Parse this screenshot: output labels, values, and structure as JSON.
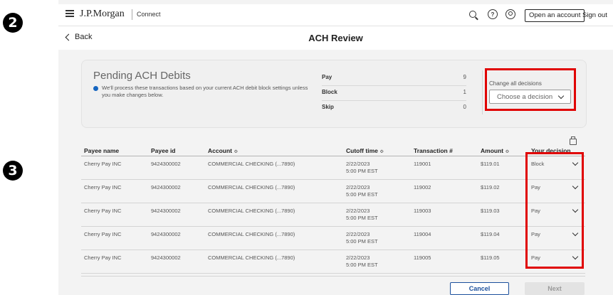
{
  "callouts": {
    "step_a": "2",
    "step_b": "3"
  },
  "header": {
    "logo": "J.P.Morgan",
    "product": "Connect",
    "open_account": "Open an account",
    "sign_out": "Sign out",
    "help_glyph": "?"
  },
  "subheader": {
    "back": "Back",
    "title": "ACH Review"
  },
  "summary_card": {
    "title": "Pending ACH Debits",
    "note": "We'll process these transactions based on your current ACH debit block settings unless you make changes below.",
    "rows": [
      {
        "label": "Pay",
        "value": "9"
      },
      {
        "label": "Block",
        "value": "1"
      },
      {
        "label": "Skip",
        "value": "0"
      }
    ],
    "change_all_label": "Change all decisions",
    "change_all_placeholder": "Choose a decision"
  },
  "table": {
    "columns": [
      "Payee name",
      "Payee id",
      "Account",
      "Cutoff time",
      "Transaction #",
      "Amount",
      "Your decision"
    ],
    "sort_glyph": "≎",
    "rows": [
      {
        "payee": "Cherry Pay INC",
        "payee_id": "9424300002",
        "account": "COMMERCIAL CHECKING (...7890)",
        "cutoff_date": "2/22/2023",
        "cutoff_time": "5:00 PM EST",
        "txn": "119001",
        "amount": "$119.01",
        "decision": "Block"
      },
      {
        "payee": "Cherry Pay INC",
        "payee_id": "9424300002",
        "account": "COMMERCIAL CHECKING (...7890)",
        "cutoff_date": "2/22/2023",
        "cutoff_time": "5:00 PM EST",
        "txn": "119002",
        "amount": "$119.02",
        "decision": "Pay"
      },
      {
        "payee": "Cherry Pay INC",
        "payee_id": "9424300002",
        "account": "COMMERCIAL CHECKING (...7890)",
        "cutoff_date": "2/22/2023",
        "cutoff_time": "5:00 PM EST",
        "txn": "119003",
        "amount": "$119.03",
        "decision": "Pay"
      },
      {
        "payee": "Cherry Pay INC",
        "payee_id": "9424300002",
        "account": "COMMERCIAL CHECKING (...7890)",
        "cutoff_date": "2/22/2023",
        "cutoff_time": "5:00 PM EST",
        "txn": "119004",
        "amount": "$119.04",
        "decision": "Pay"
      },
      {
        "payee": "Cherry Pay INC",
        "payee_id": "9424300002",
        "account": "COMMERCIAL CHECKING (...7890)",
        "cutoff_date": "2/22/2023",
        "cutoff_time": "5:00 PM EST",
        "txn": "119005",
        "amount": "$119.05",
        "decision": "Pay"
      }
    ]
  },
  "footer": {
    "cancel": "Cancel",
    "next": "Next"
  },
  "colors": {
    "highlight": "#e00000",
    "accent": "#1a4f9c",
    "info_dot": "#1565c0"
  },
  "icons": [
    "menu-icon",
    "search-icon",
    "help-icon",
    "user-icon",
    "back-chevron-icon",
    "chevron-down-icon",
    "print-icon",
    "info-dot-icon",
    "sort-icon"
  ]
}
